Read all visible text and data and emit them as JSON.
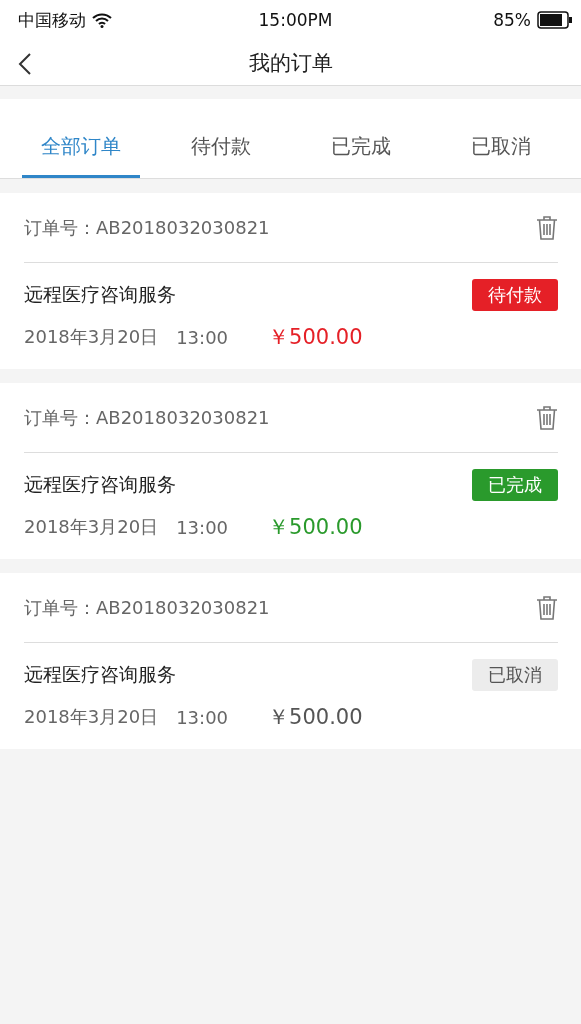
{
  "status_bar": {
    "carrier": "中国移动",
    "time": "15:00PM",
    "battery": "85%"
  },
  "header": {
    "title": "我的订单"
  },
  "tabs": [
    {
      "label": "全部订单",
      "selected": true
    },
    {
      "label": "待付款",
      "selected": false
    },
    {
      "label": "已完成",
      "selected": false
    },
    {
      "label": "已取消",
      "selected": false
    }
  ],
  "orders": [
    {
      "order_no": "订单号：AB2018032030821",
      "service": "远程医疗咨询服务",
      "date": "2018年3月20日",
      "time": "13:00",
      "price": "￥500.00",
      "status": {
        "kind": "pending",
        "label": "待付款"
      }
    },
    {
      "order_no": "订单号：AB2018032030821",
      "service": "远程医疗咨询服务",
      "date": "2018年3月20日",
      "time": "13:00",
      "price": "￥500.00",
      "status": {
        "kind": "done",
        "label": "已完成"
      }
    },
    {
      "order_no": "订单号：AB2018032030821",
      "service": "远程医疗咨询服务",
      "date": "2018年3月20日",
      "time": "13:00",
      "price": "￥500.00",
      "status": {
        "kind": "cancelled",
        "label": "已取消"
      }
    }
  ]
}
